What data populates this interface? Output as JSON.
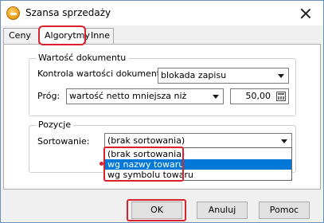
{
  "window": {
    "title": "Szansa sprzedaży"
  },
  "tabs": [
    {
      "label": "Ceny"
    },
    {
      "label": "Algorytmy"
    },
    {
      "label": "Inne"
    }
  ],
  "active_tab": "Algorytmy",
  "document_value_group": {
    "title": "Wartość dokumentu",
    "control_label": "Kontrola wartości dokumentu:",
    "control_value": "blokada zapisu",
    "threshold_label": "Próg:",
    "threshold_condition": "wartość netto mniejsza niż",
    "threshold_amount": "50,00"
  },
  "items_group": {
    "title": "Pozycje",
    "sort_label": "Sortowanie:",
    "sort_value": "(brak sortowania)",
    "sort_options": [
      "(brak sortowania)",
      "wg nazwy towaru",
      "wg symbolu towaru"
    ],
    "sort_highlighted_option": "wg nazwy towaru"
  },
  "buttons": {
    "ok": "OK",
    "cancel": "Anuluj",
    "help": "Pomoc"
  },
  "icons": {
    "app": "app-logo-icon",
    "close": "close-icon",
    "calculator": "calculator-icon",
    "dropdown": "chevron-down-icon"
  },
  "colors": {
    "highlight_red": "#d9232c",
    "selection_blue": "#0078d7"
  }
}
